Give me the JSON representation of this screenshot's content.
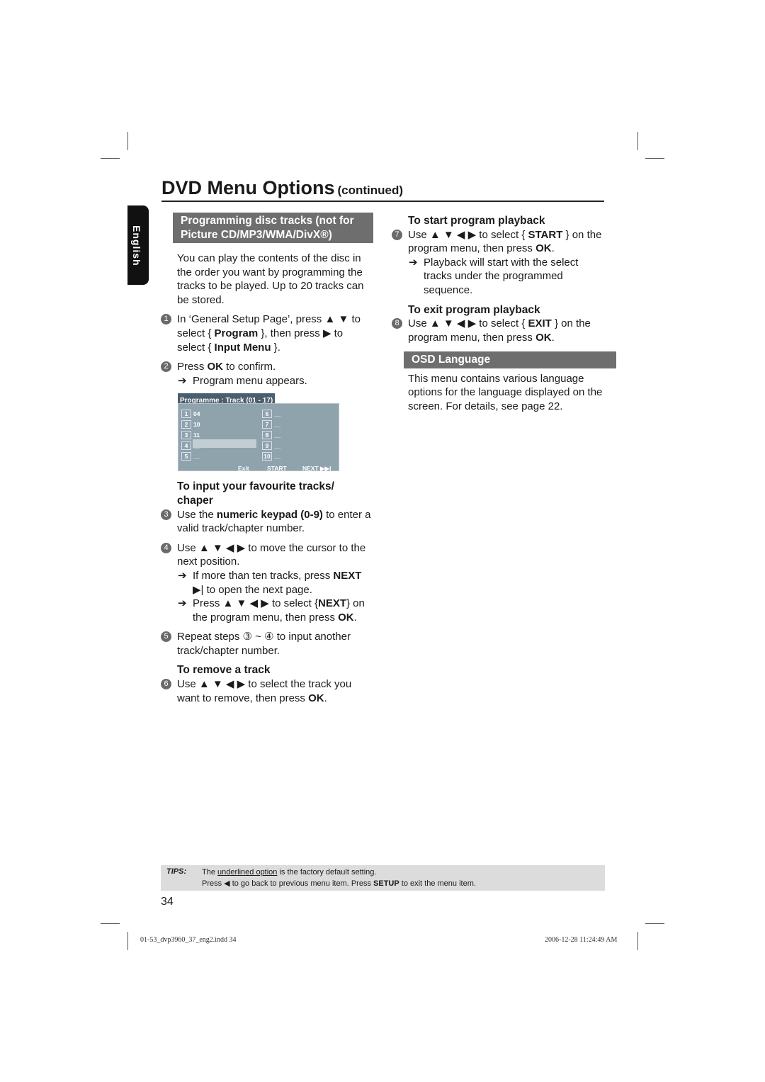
{
  "title": {
    "main": "DVD Menu Options",
    "sub": "(continued)"
  },
  "side_tab": "English",
  "left": [
    {
      "type": "box",
      "segs": [
        {
          "t": "Programming disc tracks (not for Picture CD/MP3/WMA/DivX®)"
        }
      ]
    },
    {
      "type": "para",
      "segs": [
        {
          "t": "You can play the contents of the disc in the order you want by programming the tracks to be played. Up to 20 tracks can be stored."
        }
      ]
    },
    {
      "type": "step",
      "num": "1",
      "segs": [
        {
          "t": "In ‘General Setup Page’, press ▲ ▼ to select { "
        },
        {
          "t": "Program",
          "b": 1
        },
        {
          "t": " }, then press ▶ to select { "
        },
        {
          "t": "Input Menu",
          "b": 1
        },
        {
          "t": " }."
        }
      ]
    },
    {
      "type": "step",
      "num": "2",
      "segs": [
        {
          "t": "Press "
        },
        {
          "t": "OK",
          "b": 1
        },
        {
          "t": " to confirm."
        }
      ]
    },
    {
      "type": "arrow",
      "segs": [
        {
          "t": "Program menu appears."
        }
      ]
    },
    {
      "type": "menu"
    },
    {
      "type": "heading",
      "segs": [
        {
          "t": "To input your favourite tracks/ chaper"
        }
      ]
    },
    {
      "type": "step",
      "num": "3",
      "segs": [
        {
          "t": "Use the "
        },
        {
          "t": "numeric keypad (0-9)",
          "b": 1
        },
        {
          "t": " to enter a valid track/chapter number."
        }
      ]
    },
    {
      "type": "step",
      "num": "4",
      "segs": [
        {
          "t": "Use ▲ ▼ ◀ ▶ to move the cursor to the next position."
        }
      ]
    },
    {
      "type": "arrow",
      "segs": [
        {
          "t": "If more than ten tracks, press "
        },
        {
          "t": "NEXT",
          "b": 1
        },
        {
          "t": " ▶| to open the next page."
        }
      ]
    },
    {
      "type": "arrow",
      "segs": [
        {
          "t": "Press ▲ ▼ ◀ ▶ to select {"
        },
        {
          "t": "NEXT",
          "b": 1
        },
        {
          "t": "} on the program menu, then press "
        },
        {
          "t": "OK",
          "b": 1
        },
        {
          "t": "."
        }
      ]
    },
    {
      "type": "step",
      "num": "5",
      "segs": [
        {
          "t": "Repeat steps ③ ~ ④ to input another track/chapter number."
        }
      ]
    },
    {
      "type": "heading",
      "segs": [
        {
          "t": "To remove a track"
        }
      ]
    },
    {
      "type": "step",
      "num": "6",
      "segs": [
        {
          "t": "Use ▲ ▼ ◀ ▶ to select the track you want to remove, then press "
        },
        {
          "t": "OK",
          "b": 1
        },
        {
          "t": "."
        }
      ]
    }
  ],
  "right": [
    {
      "type": "heading",
      "segs": [
        {
          "t": "To start program playback"
        }
      ]
    },
    {
      "type": "step",
      "num": "7",
      "segs": [
        {
          "t": "Use ▲ ▼ ◀ ▶ to select { "
        },
        {
          "t": "START",
          "b": 1
        },
        {
          "t": " } on the program menu, then press "
        },
        {
          "t": "OK",
          "b": 1
        },
        {
          "t": "."
        }
      ]
    },
    {
      "type": "arrow",
      "segs": [
        {
          "t": "Playback will start with the select tracks under the programmed sequence."
        }
      ]
    },
    {
      "type": "heading",
      "segs": [
        {
          "t": "To exit program playback"
        }
      ]
    },
    {
      "type": "step",
      "num": "8",
      "segs": [
        {
          "t": "Use ▲ ▼ ◀ ▶ to select { "
        },
        {
          "t": "EXIT",
          "b": 1
        },
        {
          "t": " } on the program menu, then press "
        },
        {
          "t": "OK",
          "b": 1
        },
        {
          "t": "."
        }
      ]
    },
    {
      "type": "osd",
      "segs": [
        {
          "t": "OSD Language"
        }
      ]
    },
    {
      "type": "para",
      "segs": [
        {
          "t": "This menu contains various language options for the language displayed on the screen. For details, see page 22."
        }
      ]
    }
  ],
  "program_menu": {
    "tab": "Programme : Track (01 - 17)",
    "slots": [
      {
        "n": "1",
        "v": "04"
      },
      {
        "n": "2",
        "v": "10"
      },
      {
        "n": "3",
        "v": "11"
      },
      {
        "n": "4",
        "v": "__"
      },
      {
        "n": "5",
        "v": "__"
      },
      {
        "n": "6",
        "v": "__"
      },
      {
        "n": "7",
        "v": "__"
      },
      {
        "n": "8",
        "v": "__"
      },
      {
        "n": "9",
        "v": "__"
      },
      {
        "n": "10",
        "v": "__"
      }
    ],
    "exit": "Exit",
    "start": "START",
    "next": "NEXT ▶▶|"
  },
  "tips": {
    "label": "TIPS:",
    "l1a": "The ",
    "l1u": "underlined option",
    "l1b": " is the factory default setting.",
    "l2a": "Press ◀ to go back to previous menu item. Press ",
    "l2b": "SETUP",
    "l2c": " to exit the menu item."
  },
  "page_number": "34",
  "footer": {
    "file": "01-53_dvp3960_37_eng2.indd   34",
    "date": "2006-12-28   11:24:49 AM"
  }
}
